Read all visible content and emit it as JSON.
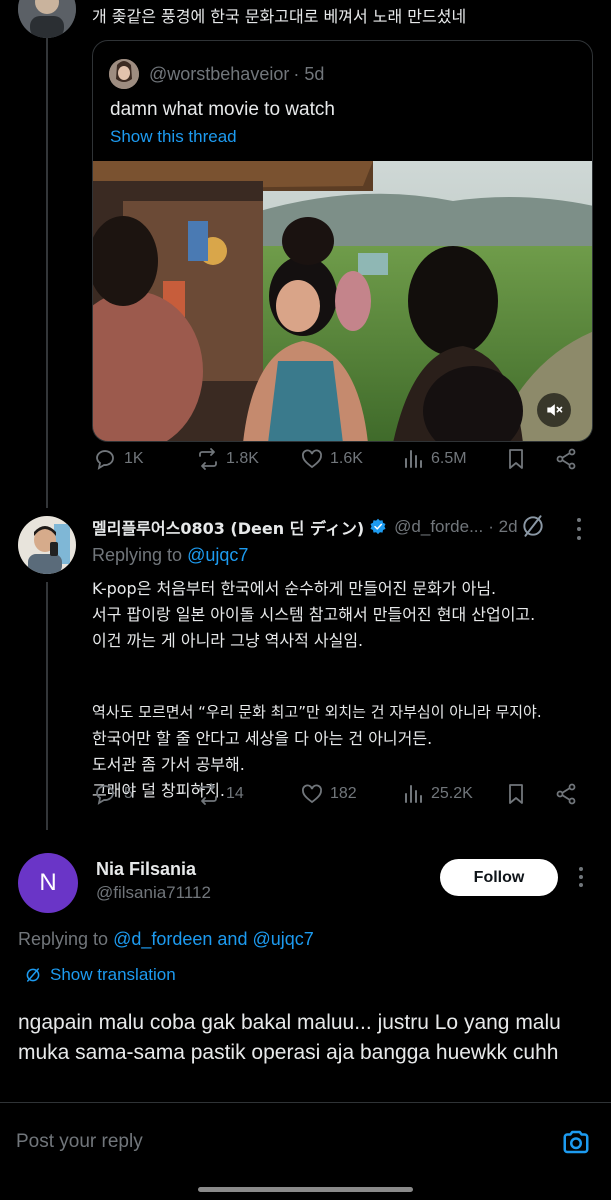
{
  "top_post": {
    "text": "개 좆같은 풍경에 한국 문화고대로 베껴서 노래 만드셨네"
  },
  "quote": {
    "handle": "@worstbehaveior",
    "age": "· 5d",
    "text": "damn what movie to watch",
    "show_thread": "Show this thread"
  },
  "top_actions": {
    "replies": "1K",
    "reposts": "1.8K",
    "likes": "1.6K",
    "views": "6.5M"
  },
  "reply1": {
    "display_name": "멜리플루어스0803 (Deen 딘 ディン)",
    "handle": "@d_forde...",
    "age": "· 2d",
    "replying_label": "Replying to",
    "replying_to": "@ujqc7",
    "lines": [
      "K-pop은 처음부터 한국에서 순수하게 만들어진 문화가 아님.",
      "서구 팝이랑 일본 아이돌 시스템 참고해서 만들어진 현대 산업이고.",
      "이건 까는 게 아니라 그냥 역사적 사실임.",
      "",
      "역사도 모르면서 “우리 문화 최고”만 외치는 건 자부심이 아니라 무지야.",
      "한국어만 할 줄 안다고 세상을 다 아는 건 아니거든.",
      "도서관 좀 가서 공부해.",
      "그래야 덜 창피하지."
    ],
    "actions": {
      "replies": "5",
      "reposts": "14",
      "likes": "182",
      "views": "25.2K"
    }
  },
  "main_post": {
    "avatar_letter": "N",
    "display_name": "Nia Filsania",
    "handle": "@filsania71112",
    "follow_label": "Follow",
    "replying_label": "Replying to",
    "replying_to": "@d_fordeen and @ujqc7",
    "show_translation": "Show translation",
    "text": "ngapain malu coba gak bakal maluu... justru Lo yang malu muka sama-sama pastik operasi aja bangga huewkk cuhh"
  },
  "reply_bar": {
    "placeholder": "Post your reply"
  },
  "colors": {
    "accent": "#1d9bf0",
    "background": "#000000",
    "muted": "#71767b",
    "avatar_purple": "#6a35c7",
    "verified": "#1d9bf0"
  }
}
